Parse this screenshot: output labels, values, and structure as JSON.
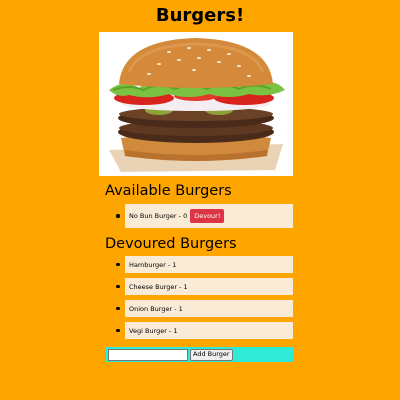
{
  "page": {
    "title": "Burgers!"
  },
  "hero": {
    "image": "burger-photo"
  },
  "available": {
    "heading": "Available Burgers",
    "items": [
      {
        "label": "No Bun Burger - 0",
        "button_label": "Devour!"
      }
    ]
  },
  "devoured": {
    "heading": "Devoured Burgers",
    "items": [
      {
        "label": "Hamburger - 1"
      },
      {
        "label": "Cheese Burger - 1"
      },
      {
        "label": "Onion Burger - 1"
      },
      {
        "label": "Vegi Burger - 1"
      }
    ]
  },
  "form": {
    "input_value": "",
    "button_label": "Add Burger"
  },
  "colors": {
    "background": "#FFA500",
    "list_item_bg": "#FAEBD7",
    "devour_button": "#DC3545",
    "form_bar": "#2FEAD6"
  }
}
